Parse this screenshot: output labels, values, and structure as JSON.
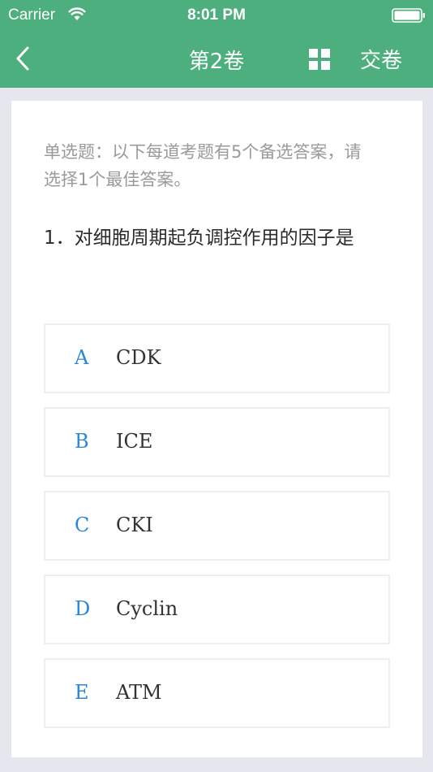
{
  "status_bar": {
    "carrier": "Carrier",
    "time": "8:01 PM"
  },
  "nav": {
    "title": "第2卷",
    "submit_label": "交卷"
  },
  "question": {
    "instruction": "单选题：以下每道考题有5个备选答案，请选择1个最佳答案。",
    "text": "1．对细胞周期起负调控作用的因子是",
    "options": [
      {
        "letter": "A",
        "text": "CDK"
      },
      {
        "letter": "B",
        "text": "ICE"
      },
      {
        "letter": "C",
        "text": "CKI"
      },
      {
        "letter": "D",
        "text": "Cyclin"
      },
      {
        "letter": "E",
        "text": "ATM"
      }
    ]
  },
  "colors": {
    "header": "#4caf7d",
    "option_letter": "#2a86d9",
    "background": "#e6e7ee"
  }
}
